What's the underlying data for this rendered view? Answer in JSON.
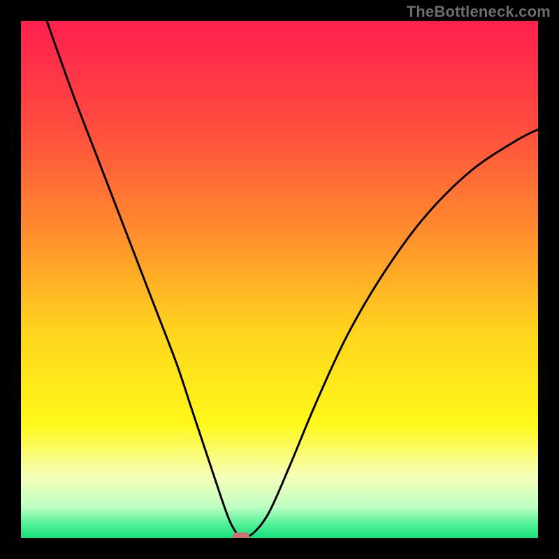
{
  "watermark": "TheBottleneck.com",
  "chart_data": {
    "type": "line",
    "title": "",
    "xlabel": "",
    "ylabel": "",
    "xlim": [
      0,
      1
    ],
    "ylim": [
      0,
      1
    ],
    "gradient_stops": [
      {
        "offset": 0.0,
        "color": "#ff1f4f"
      },
      {
        "offset": 0.2,
        "color": "#ff4b3f"
      },
      {
        "offset": 0.4,
        "color": "#ff8a2e"
      },
      {
        "offset": 0.6,
        "color": "#ffd41e"
      },
      {
        "offset": 0.78,
        "color": "#fff81a"
      },
      {
        "offset": 0.88,
        "color": "#f6ffb8"
      },
      {
        "offset": 0.94,
        "color": "#bfffc4"
      },
      {
        "offset": 0.97,
        "color": "#5bf29a"
      },
      {
        "offset": 1.0,
        "color": "#13e07a"
      }
    ],
    "series": [
      {
        "name": "bottleneck-curve",
        "x": [
          0.05,
          0.1,
          0.15,
          0.2,
          0.25,
          0.3,
          0.33,
          0.36,
          0.39,
          0.405,
          0.418,
          0.425,
          0.43,
          0.45,
          0.48,
          0.52,
          0.57,
          0.63,
          0.7,
          0.78,
          0.87,
          0.96,
          1.0
        ],
        "y": [
          1.0,
          0.86,
          0.73,
          0.6,
          0.47,
          0.34,
          0.25,
          0.16,
          0.07,
          0.03,
          0.008,
          0.003,
          0.002,
          0.01,
          0.05,
          0.14,
          0.26,
          0.39,
          0.51,
          0.62,
          0.71,
          0.77,
          0.79
        ]
      }
    ],
    "marker": {
      "x": 0.425,
      "y": 0.003
    }
  }
}
